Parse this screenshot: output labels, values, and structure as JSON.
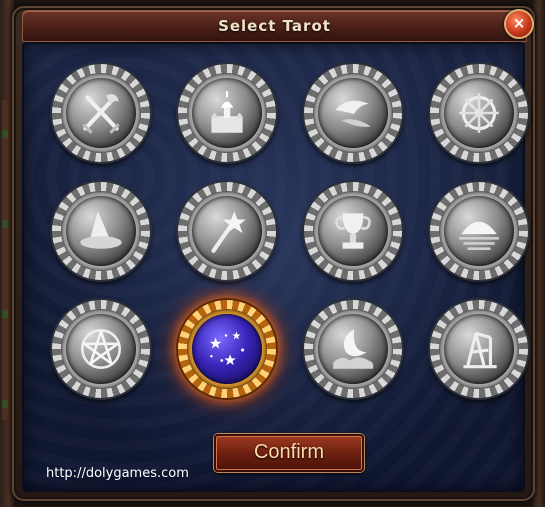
{
  "dialog": {
    "title": "Select Tarot",
    "close_label": "×",
    "confirm_label": "Confirm"
  },
  "colors": {
    "title_bar": "#5a2a20",
    "panel": "#1a2342",
    "selected_glow": "#ff7a1a",
    "confirm": "#7a2614"
  },
  "cards": [
    {
      "icon": "crossed-swords-icon",
      "selected": false
    },
    {
      "icon": "castle-icon",
      "selected": false
    },
    {
      "icon": "cloth-scroll-icon",
      "selected": false
    },
    {
      "icon": "dharma-wheel-icon",
      "selected": false
    },
    {
      "icon": "wizard-hat-icon",
      "selected": false
    },
    {
      "icon": "magic-staff-icon",
      "selected": false
    },
    {
      "icon": "trophy-cup-icon",
      "selected": false
    },
    {
      "icon": "sunset-icon",
      "selected": false
    },
    {
      "icon": "pentacle-icon",
      "selected": false
    },
    {
      "icon": "star-orb-icon",
      "selected": true
    },
    {
      "icon": "crescent-moon-icon",
      "selected": false
    },
    {
      "icon": "tower-ruin-icon",
      "selected": false
    }
  ],
  "watermark": "http://dolygames.com"
}
